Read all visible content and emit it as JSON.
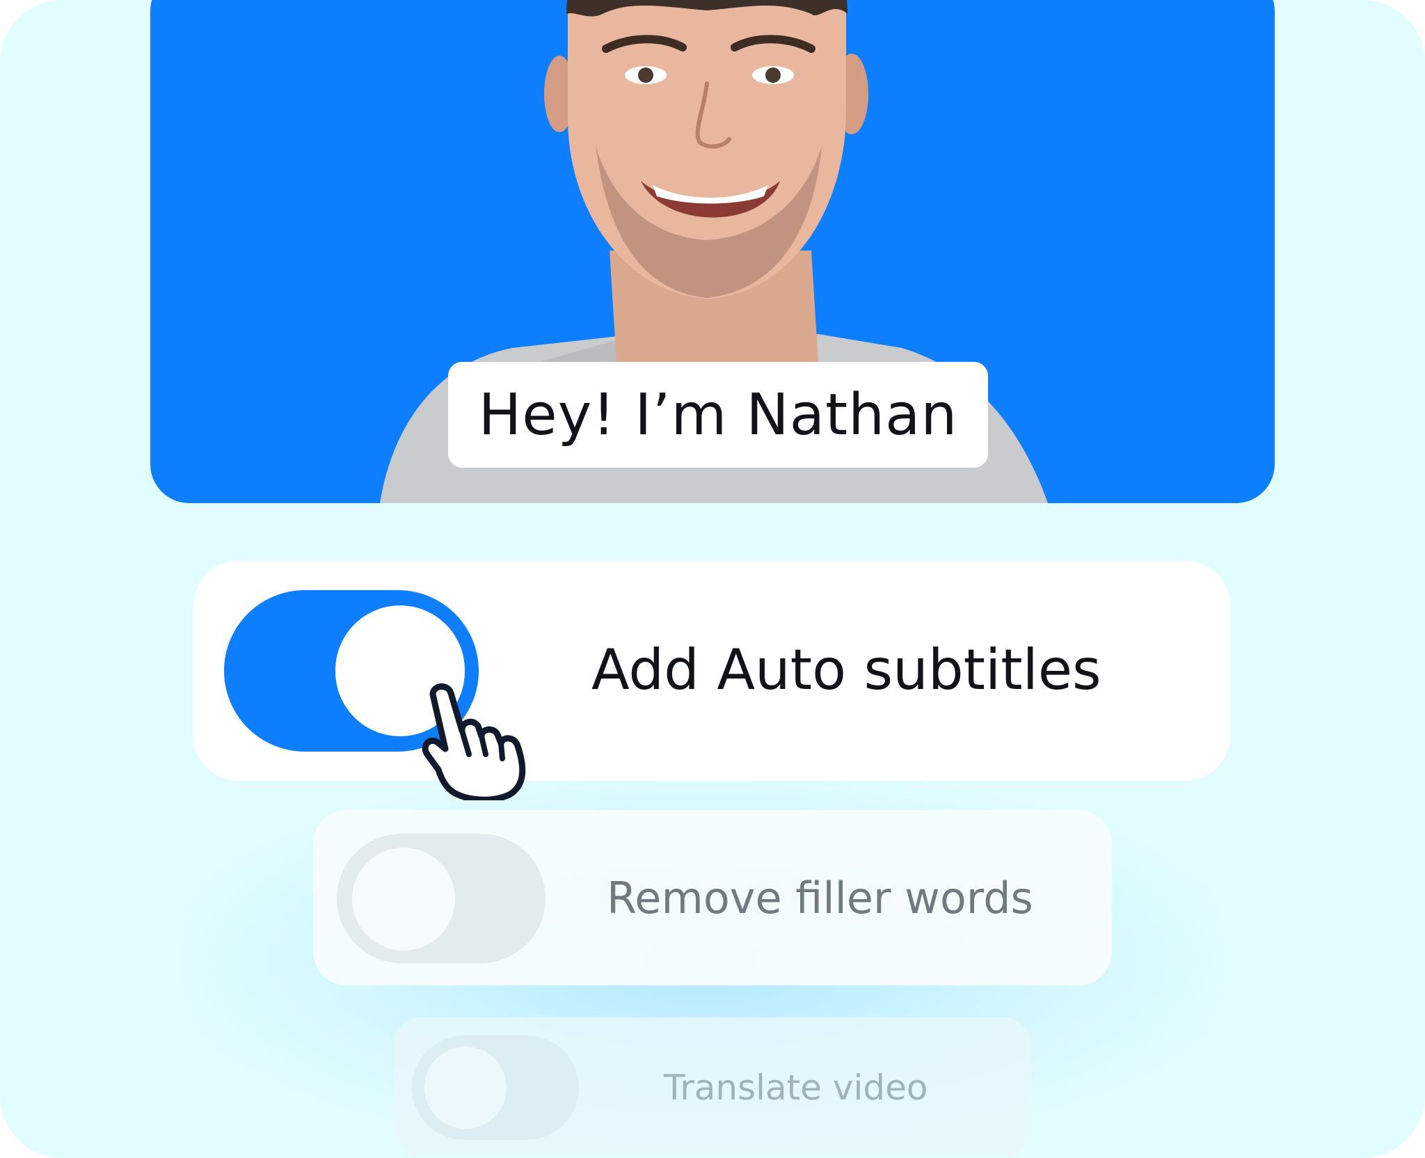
{
  "video": {
    "caption": "Hey! I’m Nathan",
    "background_color": "#0d7efe"
  },
  "options": [
    {
      "label": "Add Auto subtitles",
      "enabled": true,
      "icon": "toggle-on"
    },
    {
      "label": "Remove filler words",
      "enabled": false,
      "icon": "toggle-off"
    },
    {
      "label": "Translate video",
      "enabled": false,
      "icon": "toggle-off"
    }
  ],
  "cursor": {
    "icon": "hand-pointer-icon"
  },
  "colors": {
    "accent": "#0d7efe",
    "page_background": "#e2fdff",
    "text_primary": "#111318",
    "text_secondary": "#6f7b80",
    "text_faded": "#9fb3ba"
  }
}
